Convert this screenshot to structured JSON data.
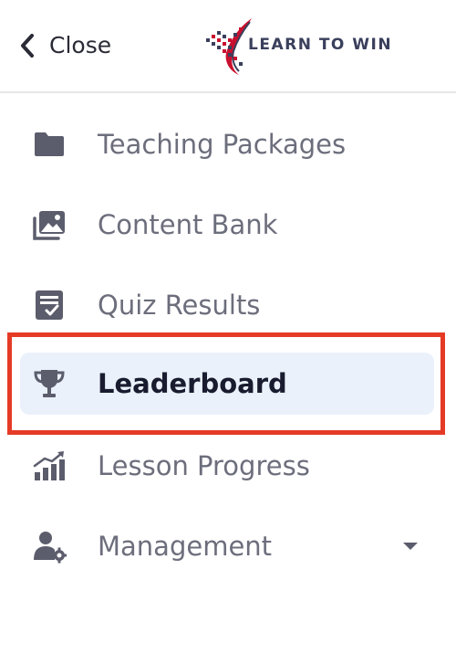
{
  "header": {
    "close_label": "Close",
    "logo_text": "LEARN TO WIN"
  },
  "nav": {
    "items": [
      {
        "label": "Teaching Packages",
        "icon": "folder-icon"
      },
      {
        "label": "Content Bank",
        "icon": "images-stack-icon"
      },
      {
        "label": "Quiz Results",
        "icon": "clipboard-check-icon"
      },
      {
        "label": "Leaderboard",
        "icon": "trophy-icon",
        "active": true
      },
      {
        "label": "Lesson Progress",
        "icon": "bar-chart-trend-icon"
      },
      {
        "label": "Management",
        "icon": "user-gear-icon",
        "expandable": true
      }
    ]
  },
  "colors": {
    "icon": "#5b5d6c",
    "label": "#6c6e7c",
    "active_bg": "#eaf1fb",
    "active_label": "#191b2e",
    "highlight": "#e53b26",
    "logo_red": "#c8102e",
    "logo_navy": "#3a3f5c"
  }
}
